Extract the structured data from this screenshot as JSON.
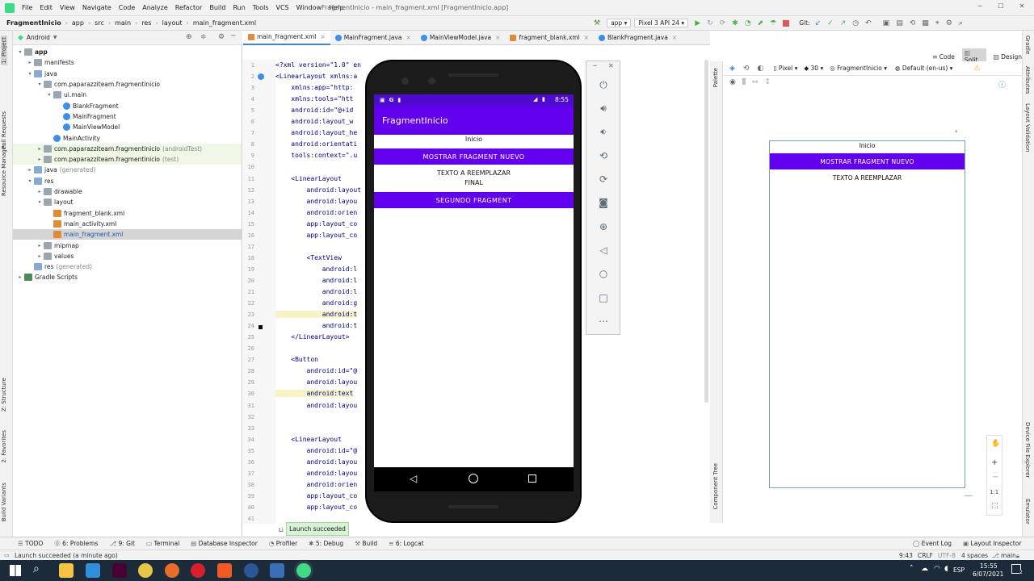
{
  "menubar": {
    "items": [
      "File",
      "Edit",
      "View",
      "Navigate",
      "Code",
      "Analyze",
      "Refactor",
      "Build",
      "Run",
      "Tools",
      "VCS",
      "Window",
      "Help"
    ],
    "window_title": "FragmentInicio - main_fragment.xml [FragmentInicio.app]"
  },
  "navbar": {
    "breadcrumb": [
      "FragmentInicio",
      "app",
      "src",
      "main",
      "res",
      "layout",
      "main_fragment.xml"
    ],
    "run_config": "app",
    "device": "Pixel 3 API 24",
    "git_label": "Git:"
  },
  "left_stripe": {
    "labels": [
      "1: Project",
      "Pull Requests",
      "Resource Manager",
      "Z: Structure",
      "2: Favorites",
      "Build Variants"
    ]
  },
  "right_stripe": {
    "labels": [
      "Gradle",
      "Attributes",
      "Layout Validation",
      "Device File Explorer",
      "Emulator"
    ]
  },
  "project": {
    "view": "Android",
    "tree": [
      {
        "label": "app",
        "depth": 0,
        "arrow": "▾",
        "icon": "folder",
        "bold": true
      },
      {
        "label": "manifests",
        "depth": 1,
        "arrow": "▸",
        "icon": "folder"
      },
      {
        "label": "java",
        "depth": 1,
        "arrow": "▾",
        "icon": "folder"
      },
      {
        "label": "com.paparazziteam.fragmentinicio",
        "depth": 2,
        "arrow": "▾",
        "icon": "folder"
      },
      {
        "label": "ui.main",
        "depth": 3,
        "arrow": "▾",
        "icon": "folder"
      },
      {
        "label": "BlankFragment",
        "depth": 4,
        "arrow": "",
        "icon": "class"
      },
      {
        "label": "MainFragment",
        "depth": 4,
        "arrow": "",
        "icon": "class"
      },
      {
        "label": "MainViewModel",
        "depth": 4,
        "arrow": "",
        "icon": "class"
      },
      {
        "label": "MainActivity",
        "depth": 3,
        "arrow": "",
        "icon": "class"
      },
      {
        "label": "com.paparazziteam.fragmentinicio",
        "suffix": "(androidTest)",
        "depth": 2,
        "arrow": "▸",
        "icon": "folder",
        "green": true
      },
      {
        "label": "com.paparazziteam.fragmentinicio",
        "suffix": "(test)",
        "depth": 2,
        "arrow": "▸",
        "icon": "folder",
        "green": true
      },
      {
        "label": "java",
        "suffix": "(generated)",
        "depth": 1,
        "arrow": "▸",
        "icon": "folder"
      },
      {
        "label": "res",
        "depth": 1,
        "arrow": "▾",
        "icon": "folder"
      },
      {
        "label": "drawable",
        "depth": 2,
        "arrow": "▸",
        "icon": "folder"
      },
      {
        "label": "layout",
        "depth": 2,
        "arrow": "▾",
        "icon": "folder"
      },
      {
        "label": "fragment_blank.xml",
        "depth": 3,
        "arrow": "",
        "icon": "xml"
      },
      {
        "label": "main_activity.xml",
        "depth": 3,
        "arrow": "",
        "icon": "xml"
      },
      {
        "label": "main_fragment.xml",
        "depth": 3,
        "arrow": "",
        "icon": "xml",
        "selected": true
      },
      {
        "label": "mipmap",
        "depth": 2,
        "arrow": "▸",
        "icon": "folder"
      },
      {
        "label": "values",
        "depth": 2,
        "arrow": "▸",
        "icon": "folder"
      },
      {
        "label": "res",
        "suffix": "(generated)",
        "depth": 1,
        "arrow": "",
        "icon": "folder"
      },
      {
        "label": "Gradle Scripts",
        "depth": 0,
        "arrow": "▸",
        "icon": "gradle"
      }
    ]
  },
  "editor": {
    "tabs": [
      "main_fragment.xml",
      "MainFragment.java",
      "MainViewModel.java",
      "fragment_blank.xml",
      "BlankFragment.java"
    ],
    "view_modes": [
      "Code",
      "Split",
      "Design"
    ],
    "warnings": "3",
    "ok_count": "6",
    "lines": [
      {
        "n": "1",
        "t": "<?xml version=\"1.0\" en"
      },
      {
        "n": "2",
        "t": "<LinearLayout xmlns:a"
      },
      {
        "n": "3",
        "t": "    xmlns:app=\"http:"
      },
      {
        "n": "4",
        "t": "    xmlns:tools=\"htt"
      },
      {
        "n": "5",
        "t": "    android:id=\"@+id"
      },
      {
        "n": "6",
        "t": "    android:layout_w"
      },
      {
        "n": "7",
        "t": "    android:layout_he"
      },
      {
        "n": "8",
        "t": "    android:orientati"
      },
      {
        "n": "9",
        "t": "    tools:context=\".u"
      },
      {
        "n": "10",
        "t": ""
      },
      {
        "n": "11",
        "t": "    <LinearLayout"
      },
      {
        "n": "12",
        "t": "        android:layout"
      },
      {
        "n": "13",
        "t": "        android:layou"
      },
      {
        "n": "14",
        "t": "        android:orien"
      },
      {
        "n": "15",
        "t": "        app:layout_co"
      },
      {
        "n": "16",
        "t": "        app:layout_co"
      },
      {
        "n": "17",
        "t": ""
      },
      {
        "n": "18",
        "t": "        <TextView"
      },
      {
        "n": "19",
        "t": "            android:l"
      },
      {
        "n": "20",
        "t": "            android:l"
      },
      {
        "n": "21",
        "t": "            android:l"
      },
      {
        "n": "22",
        "t": "            android:g"
      },
      {
        "n": "23",
        "t": "            android:t",
        "hl": true
      },
      {
        "n": "24",
        "t": "            android:t"
      },
      {
        "n": "25",
        "t": "    </LinearLayout>"
      },
      {
        "n": "26",
        "t": ""
      },
      {
        "n": "27",
        "t": "    <Button"
      },
      {
        "n": "28",
        "t": "        android:id=\"@"
      },
      {
        "n": "29",
        "t": "        android:layou"
      },
      {
        "n": "30",
        "t": "        android:text",
        "hl": true
      },
      {
        "n": "31",
        "t": "        android:layou"
      },
      {
        "n": "32",
        "t": ""
      },
      {
        "n": "33",
        "t": ""
      },
      {
        "n": "34",
        "t": "    <LinearLayout"
      },
      {
        "n": "35",
        "t": "        android:id=\"@"
      },
      {
        "n": "36",
        "t": "        android:layou"
      },
      {
        "n": "37",
        "t": "        android:layou"
      },
      {
        "n": "38",
        "t": "        android:orien"
      },
      {
        "n": "39",
        "t": "        app:layout_co"
      },
      {
        "n": "40",
        "t": "        app:layout_co"
      },
      {
        "n": "41",
        "t": ""
      }
    ]
  },
  "emulator": {
    "clock": "8:55",
    "app_title": "FragmentInicio",
    "inicio": "Inicio",
    "btn_nuevo": "MOSTRAR FRAGMENT NUEVO",
    "texto": "TEXTO A REEMPLAZAR",
    "final": "FINAL",
    "btn_segundo": "SEGUNDO FRAGMENT"
  },
  "design": {
    "device": "Pixel",
    "api": "30",
    "theme": "FragmentInicio",
    "locale": "Default (en-us)",
    "palette_label": "Palette",
    "component_tree_label": "Component Tree",
    "inicio": "Inicio",
    "btn_nuevo": "MOSTRAR FRAGMENT NUEVO",
    "texto": "TEXTO A REEMPLAZAR",
    "zoom_ratio": "1:1"
  },
  "bottom": {
    "tool_windows": [
      "TODO",
      "6: Problems",
      "9: Git",
      "Terminal",
      "Database Inspector",
      "Profiler",
      "5: Debug",
      "Build",
      "6: Logcat"
    ],
    "right_tool_windows": [
      "Event Log",
      "Layout Inspector"
    ],
    "toast": "Launch succeeded",
    "status_message": "Launch succeeded (a minute ago)",
    "caret": "9:43",
    "line_sep": "CRLF",
    "encoding": "UTF-8",
    "indent": "4 spaces",
    "branch": "main",
    "partial_tab": "Li"
  },
  "taskbar": {
    "lang": "ESP",
    "time": "15:55",
    "date": "6/07/2021",
    "notification_count": "2"
  },
  "colors": {
    "accent": "#6200ee",
    "status_bar": "#4c0bce",
    "toast_bg": "#d8f2d5",
    "taskbar": "#1c2b3a"
  }
}
